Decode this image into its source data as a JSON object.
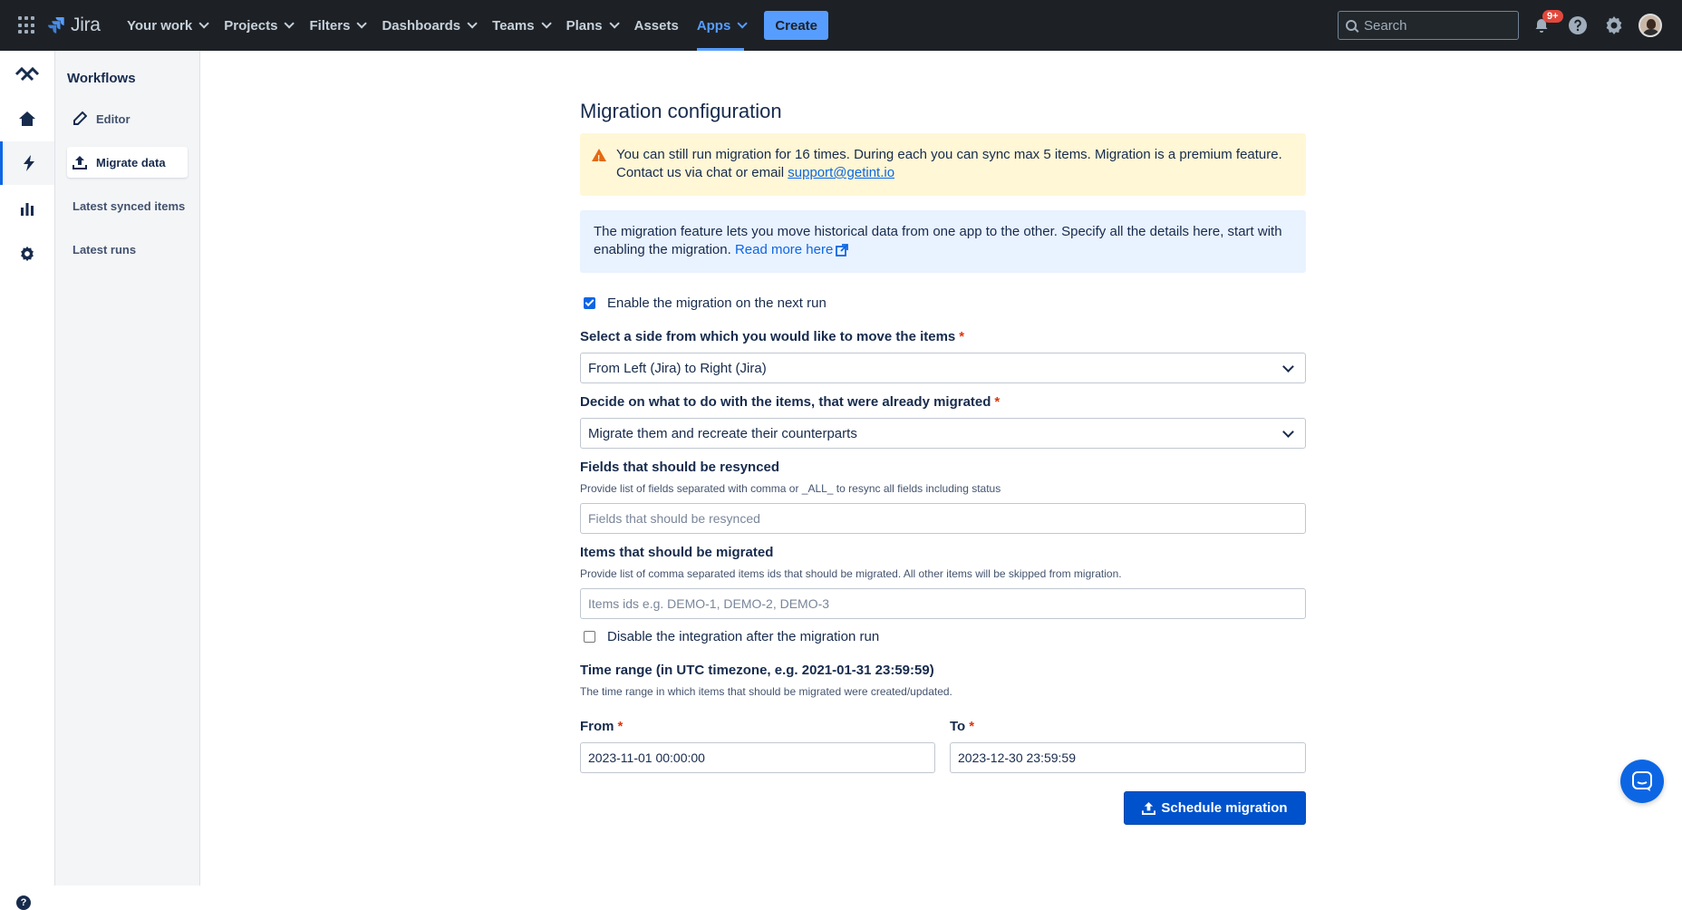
{
  "topbar": {
    "app_name": "Jira",
    "nav": [
      {
        "label": "Your work",
        "has_menu": true
      },
      {
        "label": "Projects",
        "has_menu": true
      },
      {
        "label": "Filters",
        "has_menu": true
      },
      {
        "label": "Dashboards",
        "has_menu": true
      },
      {
        "label": "Teams",
        "has_menu": true
      },
      {
        "label": "Plans",
        "has_menu": true
      },
      {
        "label": "Assets",
        "has_menu": false
      },
      {
        "label": "Apps",
        "has_menu": true,
        "active": true
      }
    ],
    "create_label": "Create",
    "search_placeholder": "Search",
    "notifications_badge": "9+",
    "colors": {
      "bar": "#1d2125",
      "accent": "#579dff"
    }
  },
  "rail": {
    "icons": [
      "logo-icon",
      "home-icon",
      "lightning-icon",
      "chart-icon",
      "gear-icon"
    ],
    "active": "lightning-icon",
    "bottom_help": "?"
  },
  "sidebar": {
    "title": "Workflows",
    "items": [
      {
        "label": "Editor",
        "icon": "pencil-icon"
      },
      {
        "label": "Migrate data",
        "icon": "upload-icon",
        "active": true
      },
      {
        "label": "Latest synced items"
      },
      {
        "label": "Latest runs"
      }
    ]
  },
  "main": {
    "title": "Migration configuration",
    "warning": {
      "text": "You can still run migration for 16 times. During each you can sync max 5 items. Migration is a premium feature. Contact us via chat or email ",
      "email": "support@getint.io"
    },
    "info": {
      "text": "The migration feature lets you move historical data from one app to the other. Specify all the details here, start with enabling the migration. ",
      "link": "Read more here"
    },
    "enable_checkbox": {
      "label": "Enable the migration on the next run",
      "checked": true
    },
    "side_select": {
      "label": "Select a side from which you would like to move the items",
      "required": "*",
      "value": "From Left (Jira) to Right (Jira)"
    },
    "migrated_select": {
      "label": "Decide on what to do with the items, that were already migrated",
      "required": "*",
      "value": "Migrate them and recreate their counterparts"
    },
    "fields_resync": {
      "label": "Fields that should be resynced",
      "helper": "Provide list of fields separated with comma or _ALL_ to resync all fields including status",
      "placeholder": "Fields that should be resynced",
      "value": ""
    },
    "items_migrate": {
      "label": "Items that should be migrated",
      "helper": "Provide list of comma separated items ids that should be migrated. All other items will be skipped from migration.",
      "placeholder": "Items ids e.g. DEMO-1, DEMO-2, DEMO-3",
      "value": ""
    },
    "disable_checkbox": {
      "label": "Disable the integration after the migration run",
      "checked": false
    },
    "time_range": {
      "label": "Time range (in UTC timezone, e.g. 2021-01-31 23:59:59)",
      "helper": "The time range in which items that should be migrated were created/updated.",
      "from_label": "From",
      "from_value": "2023-11-01 00:00:00",
      "to_label": "To",
      "to_value": "2023-12-30 23:59:59",
      "required": "*"
    },
    "schedule_button": "Schedule migration"
  }
}
